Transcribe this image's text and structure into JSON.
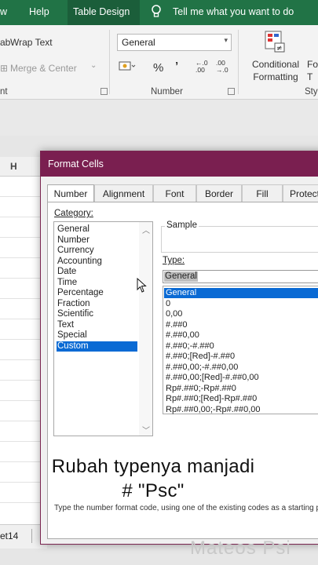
{
  "ribbon_tabs": {
    "view_partial": "w",
    "help": "Help",
    "table_design": "Table Design",
    "tell_me": "Tell me what you want to do"
  },
  "ribbon": {
    "wrap_text": "Wrap Text",
    "merge_center": "Merge & Center",
    "alignment_partial": "nt",
    "number_format_value": "General",
    "percent": "%",
    "comma": "’",
    "inc_decimal": "←.0 .00",
    "dec_decimal": ".00 →.0",
    "number_group": "Number",
    "conditional_formatting": "Conditional Formatting",
    "format_as_partial": "Fo T",
    "styles_partial": "Sty"
  },
  "sheet": {
    "column_h": "H",
    "tab_partial": "et14"
  },
  "dialog": {
    "title": "Format Cells",
    "tabs": [
      "Number",
      "Alignment",
      "Font",
      "Border",
      "Fill",
      "Protect"
    ],
    "category_label": "Category:",
    "categories": [
      "General",
      "Number",
      "Currency",
      "Accounting",
      "Date",
      "Time",
      "Percentage",
      "Fraction",
      "Scientific",
      "Text",
      "Special",
      "Custom"
    ],
    "selected_category": "Custom",
    "sample_label": "Sample",
    "type_label": "Type:",
    "type_value": "General",
    "formats": [
      "General",
      "0",
      "0,00",
      "#.##0",
      "#.##0,00",
      "#.##0;-#.##0",
      "#.##0;[Red]-#.##0",
      "#.##0,00;-#.##0,00",
      "#.##0,00;[Red]-#.##0,00",
      "Rp#.##0;-Rp#.##0",
      "Rp#.##0;[Red]-Rp#.##0",
      "Rp#.##0,00;-Rp#.##0,00"
    ],
    "hint": "Type the number format code, using one of the existing codes as a starting point."
  },
  "caption": {
    "line1": "Rubah typenya manjadi",
    "line2": "# \"Psc\""
  },
  "watermark": "Mateos Psi",
  "colors": {
    "ribbon_green": "#217346",
    "dialog_title": "#7a1f50",
    "selection_blue": "#0a6ad4"
  }
}
